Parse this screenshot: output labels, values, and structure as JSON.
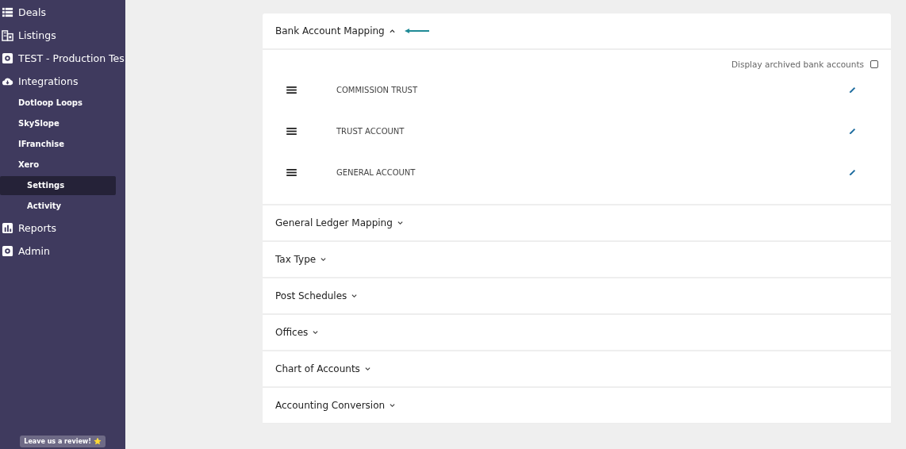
{
  "sidebar": {
    "items": [
      {
        "label": "Deals"
      },
      {
        "label": "Listings"
      },
      {
        "label": "TEST - Production Tes"
      },
      {
        "label": "Integrations",
        "children": [
          {
            "label": "Dotloop Loops",
            "selected": false
          },
          {
            "label": "SkySlope",
            "selected": false
          },
          {
            "label": "IFranchise",
            "selected": false
          },
          {
            "label": "Xero",
            "selected": false,
            "children": [
              {
                "label": "Settings",
                "selected": true
              },
              {
                "label": "Activity",
                "selected": false
              }
            ]
          }
        ]
      },
      {
        "label": "Reports"
      },
      {
        "label": "Admin"
      }
    ],
    "review_button": "Leave us a review! ⭐"
  },
  "sections": [
    {
      "title": "Bank Account Mapping",
      "expanded": true,
      "archived_label": "Display archived bank accounts",
      "archived_checked": false,
      "accounts": [
        "COMMISSION TRUST",
        "TRUST ACCOUNT",
        "GENERAL ACCOUNT"
      ]
    },
    {
      "title": "General Ledger Mapping",
      "expanded": false
    },
    {
      "title": "Tax Type",
      "expanded": false
    },
    {
      "title": "Post Schedules",
      "expanded": false
    },
    {
      "title": "Offices",
      "expanded": false
    },
    {
      "title": "Chart of Accounts",
      "expanded": false
    },
    {
      "title": "Accounting Conversion",
      "expanded": false
    }
  ]
}
